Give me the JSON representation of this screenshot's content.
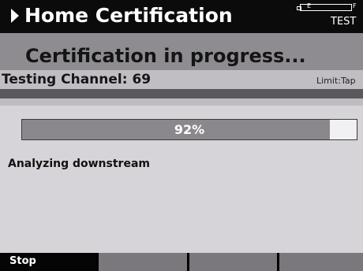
{
  "header": {
    "title": "Home Certification",
    "battery_empty": "E",
    "battery_full": "F",
    "mode": "TEST",
    "battery_level": 1.0
  },
  "banner": {
    "text": "Certification in progress..."
  },
  "channel": {
    "label": "Testing Channel: 69",
    "limit": "Limit:Tap"
  },
  "progress": {
    "value": 92,
    "label": "92%"
  },
  "status": {
    "text": "Analyzing downstream"
  },
  "softkeys": [
    {
      "label": "Stop"
    },
    {
      "label": ""
    },
    {
      "label": ""
    },
    {
      "label": ""
    }
  ],
  "colors": {
    "title_bg": "#0b0b0b",
    "banner_bg": "#8e8c90",
    "screen_bg": "#d6d4d8",
    "progress_fill": "#8a888c"
  }
}
